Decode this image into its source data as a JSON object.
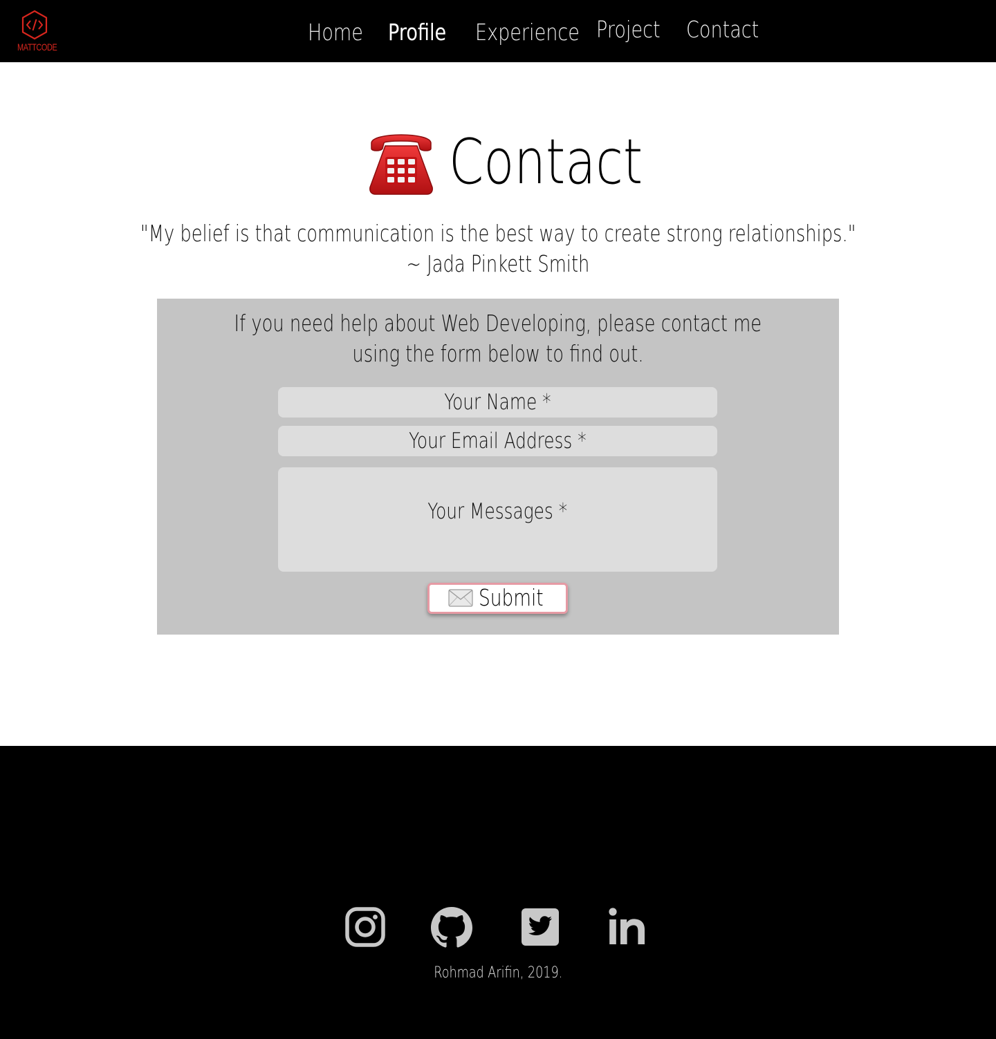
{
  "header": {
    "logo_text": "MATTCODE",
    "nav": [
      {
        "label": "Home"
      },
      {
        "label": "Profile"
      },
      {
        "label": "Experience"
      },
      {
        "label": "Project"
      },
      {
        "label": "Contact"
      }
    ]
  },
  "main": {
    "title": "Contact",
    "title_icon": "telephone-icon",
    "quote_line1": "\"My belief is that communication is the best way to create strong relationships.\"",
    "quote_line2": "~ Jada Pinkett Smith"
  },
  "form": {
    "intro_line1": "If you need help about Web Developing, please contact me",
    "intro_line2": "using the form below to find out.",
    "name_placeholder": "Your Name *",
    "email_placeholder": "Your Email Address *",
    "message_placeholder": "Your Messages *",
    "submit_label": "Submit",
    "submit_icon": "envelope-icon"
  },
  "footer": {
    "social": [
      {
        "icon": "instagram-icon"
      },
      {
        "icon": "github-icon"
      },
      {
        "icon": "twitter-icon"
      },
      {
        "icon": "linkedin-icon"
      }
    ],
    "copyright": "Rohmad Arifin, 2019."
  },
  "colors": {
    "nav_background": "#000000",
    "logo_accent": "#d8261e",
    "panel_background": "#c4c4c4",
    "field_background": "#dddddd",
    "submit_border": "#e69aa4",
    "footer_background": "#000000",
    "social_icon": "#c8c8c8"
  }
}
